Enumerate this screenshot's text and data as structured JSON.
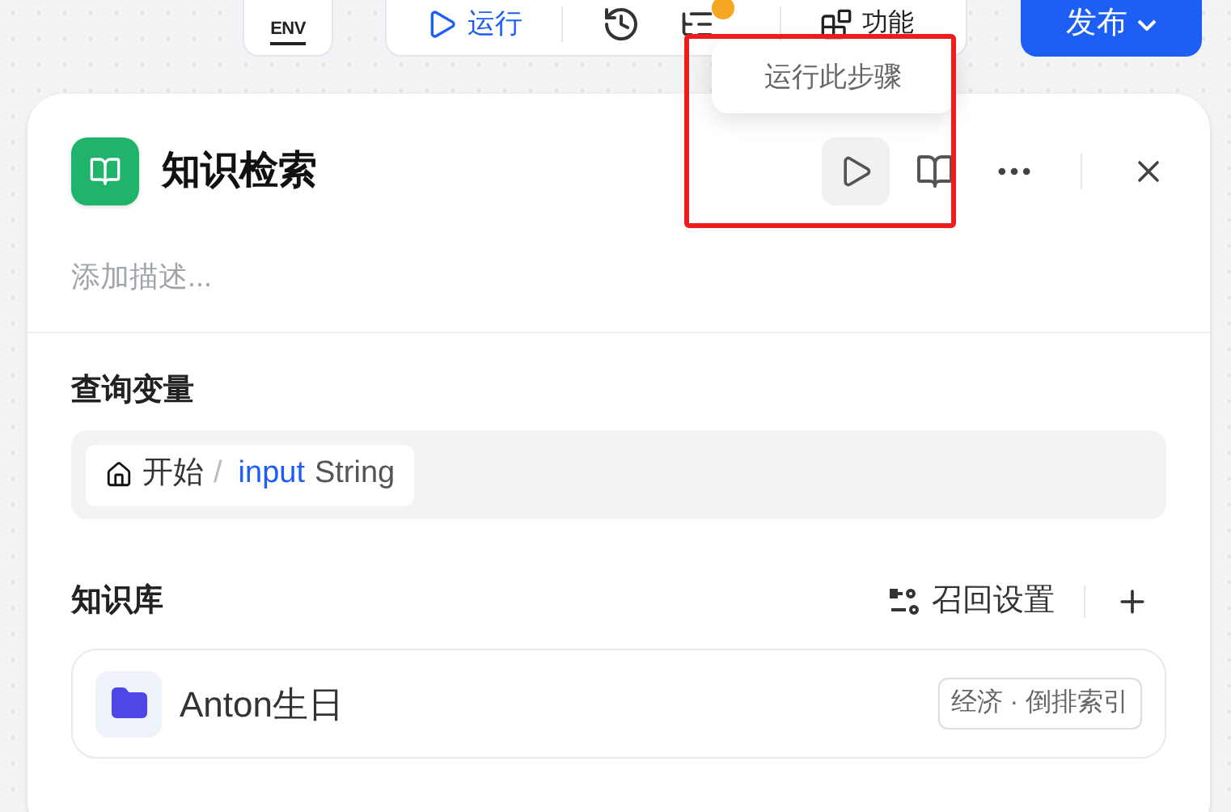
{
  "toolbar": {
    "env_label": "ENV",
    "run_label": "运行",
    "feature_label": "功能",
    "publish_label": "发布"
  },
  "tooltip": {
    "text": "运行此步骤"
  },
  "node": {
    "title": "知识检索",
    "description": {
      "placeholder": "添加描述..."
    },
    "query_section": {
      "title": "查询变量",
      "variable": {
        "source": "开始",
        "separator": "/",
        "name": "input",
        "type": "String"
      }
    },
    "knowledge_section": {
      "title": "知识库",
      "recall_settings_label": "召回设置",
      "items": [
        {
          "name": "Anton生日",
          "tag": "经济 · 倒排索引"
        }
      ]
    }
  }
}
